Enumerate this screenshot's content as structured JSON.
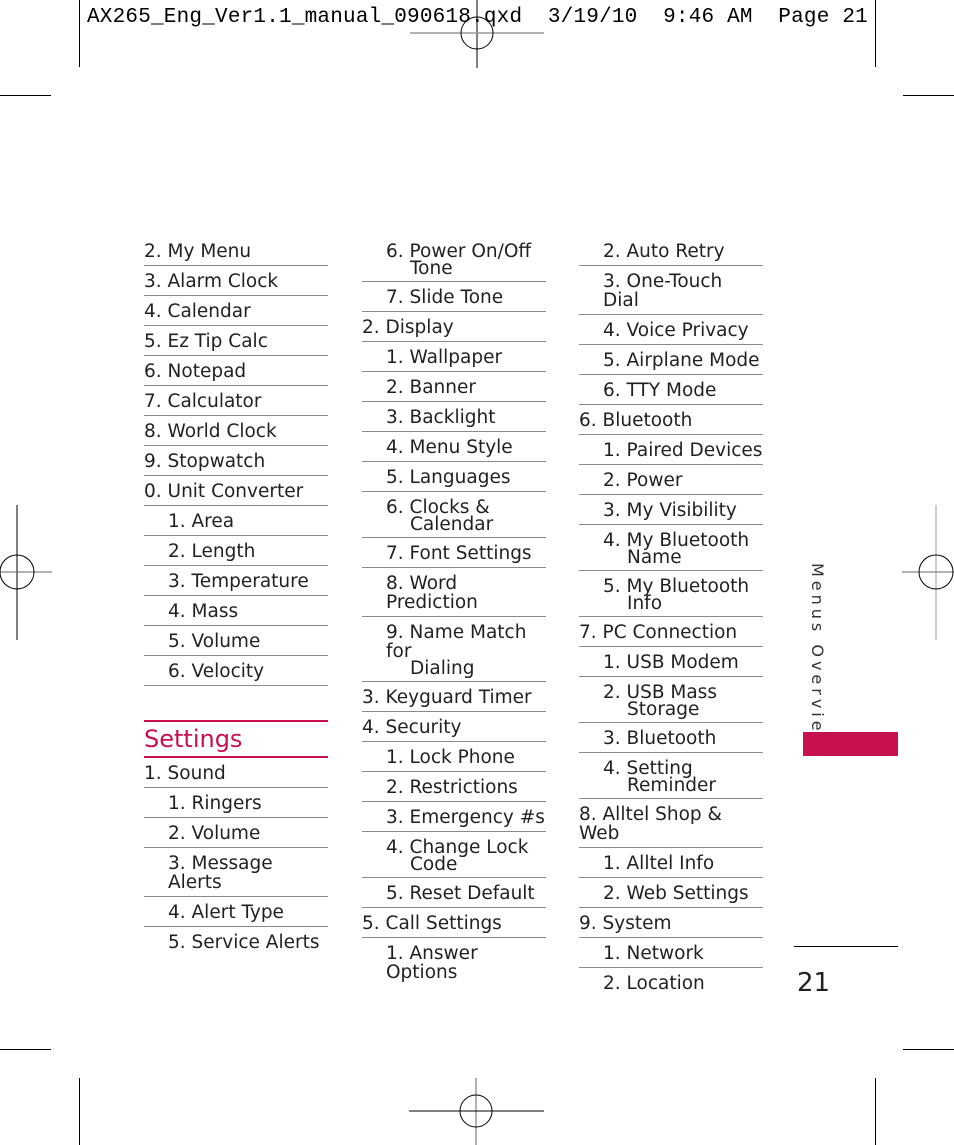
{
  "slug": {
    "text": "AX265_Eng_Ver1.1_manual_090618.qxd  3/19/10  9:46 AM  Page 21"
  },
  "columns": [
    {
      "rows": [
        {
          "label": "2. My Menu",
          "level": 1
        },
        {
          "label": "3. Alarm Clock",
          "level": 1
        },
        {
          "label": "4. Calendar",
          "level": 1
        },
        {
          "label": "5. Ez Tip Calc",
          "level": 1
        },
        {
          "label": "6. Notepad",
          "level": 1
        },
        {
          "label": "7.  Calculator",
          "level": 1
        },
        {
          "label": "8. World Clock",
          "level": 1
        },
        {
          "label": "9. Stopwatch",
          "level": 1
        },
        {
          "label": "0. Unit Converter",
          "level": 1
        },
        {
          "label": "1. Area",
          "level": 2
        },
        {
          "label": "2. Length",
          "level": 2
        },
        {
          "label": "3. Temperature",
          "level": 2
        },
        {
          "label": "4. Mass",
          "level": 2
        },
        {
          "label": "5. Volume",
          "level": 2
        },
        {
          "label": "6. Velocity",
          "level": 2
        }
      ],
      "section": {
        "title": "Settings",
        "rows": [
          {
            "label": "1. Sound",
            "level": 1
          },
          {
            "label": "1. Ringers",
            "level": 2
          },
          {
            "label": "2. Volume",
            "level": 2
          },
          {
            "label": "3. Message Alerts",
            "level": 2
          },
          {
            "label": "4. Alert Type",
            "level": 2
          },
          {
            "label": "5. Service Alerts",
            "level": 2
          }
        ]
      }
    },
    {
      "rows": [
        {
          "label": "6. Power On/Off",
          "label2": "Tone",
          "level": 2
        },
        {
          "label": "7.  Slide Tone",
          "level": 2
        },
        {
          "label": "2. Display",
          "level": 1
        },
        {
          "label": "1. Wallpaper",
          "level": 2
        },
        {
          "label": "2. Banner",
          "level": 2
        },
        {
          "label": "3. Backlight",
          "level": 2
        },
        {
          "label": "4. Menu Style",
          "level": 2
        },
        {
          "label": "5. Languages",
          "level": 2
        },
        {
          "label": "6. Clocks &",
          "label2": "Calendar",
          "level": 2
        },
        {
          "label": "7.  Font Settings",
          "level": 2
        },
        {
          "label": "8. Word Prediction",
          "level": 2
        },
        {
          "label": "9. Name Match for",
          "label2": "Dialing",
          "level": 2
        },
        {
          "label": "3. Keyguard Timer",
          "level": 1
        },
        {
          "label": "4. Security",
          "level": 1
        },
        {
          "label": "1. Lock Phone",
          "level": 2
        },
        {
          "label": "2. Restrictions",
          "level": 2
        },
        {
          "label": "3. Emergency #s",
          "level": 2
        },
        {
          "label": "4. Change Lock",
          "label2": "Code",
          "level": 2
        },
        {
          "label": "5. Reset Default",
          "level": 2
        },
        {
          "label": "5. Call Settings",
          "level": 1
        },
        {
          "label": "1. Answer Options",
          "level": 2
        }
      ]
    },
    {
      "rows": [
        {
          "label": "2. Auto Retry",
          "level": 2
        },
        {
          "label": "3. One-Touch Dial",
          "level": 2
        },
        {
          "label": "4. Voice Privacy",
          "level": 2
        },
        {
          "label": "5. Airplane Mode",
          "level": 2
        },
        {
          "label": "6. TTY Mode",
          "level": 2
        },
        {
          "label": "6. Bluetooth",
          "level": 1
        },
        {
          "label": "1. Paired Devices",
          "level": 2
        },
        {
          "label": "2. Power",
          "level": 2
        },
        {
          "label": "3. My Visibility",
          "level": 2
        },
        {
          "label": "4. My Bluetooth",
          "label2": "Name",
          "level": 2
        },
        {
          "label": "5. My Bluetooth",
          "label2": "Info",
          "level": 2
        },
        {
          "label": "7.  PC Connection",
          "level": 1
        },
        {
          "label": "1. USB Modem",
          "level": 2
        },
        {
          "label": "2. USB Mass",
          "label2": "Storage",
          "level": 2
        },
        {
          "label": "3. Bluetooth",
          "level": 2
        },
        {
          "label": "4. Setting",
          "label2": "Reminder",
          "level": 2
        },
        {
          "label": "8. Alltel Shop & Web",
          "level": 1
        },
        {
          "label": "1. Alltel Info",
          "level": 2
        },
        {
          "label": "2. Web Settings",
          "level": 2
        },
        {
          "label": "9. System",
          "level": 1
        },
        {
          "label": "1. Network",
          "level": 2
        },
        {
          "label": "2. Location",
          "level": 2
        }
      ]
    }
  ],
  "side_label": "Menus Overview",
  "page_number": "21",
  "colors": {
    "accent": "#c8104d",
    "text": "#231f20",
    "rule": "#8a8a8a"
  }
}
